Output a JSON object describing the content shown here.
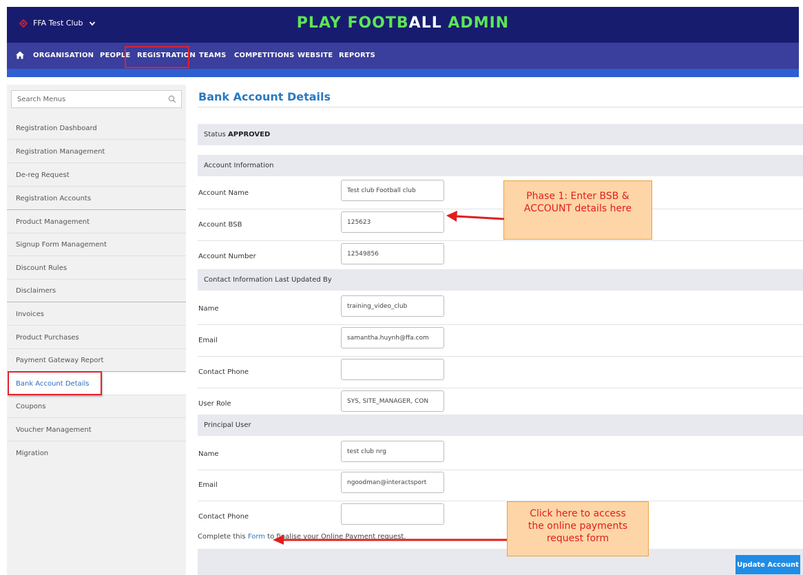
{
  "header": {
    "club_name": "FFA Test Club",
    "brand_part1": "PLAY FOOTB",
    "brand_part2": "ALL",
    "brand_part3": " ADMIN"
  },
  "nav": {
    "items": [
      "ORGANISATION",
      "PEOPLE",
      "REGISTRATION",
      "TEAMS",
      "COMPETITIONS",
      "WEBSITE",
      "REPORTS"
    ],
    "active": "REGISTRATION"
  },
  "sidebar": {
    "search_placeholder": "Search Menus",
    "items": [
      "Registration Dashboard",
      "Registration Management",
      "De-reg Request",
      "Registration Accounts",
      "Product Management",
      "Signup Form Management",
      "Discount Rules",
      "Disclaimers",
      "Invoices",
      "Product Purchases",
      "Payment Gateway Report",
      "Bank Account Details",
      "Coupons",
      "Voucher Management",
      "Migration"
    ],
    "active": "Bank Account Details"
  },
  "page": {
    "title": "Bank Account Details",
    "status_label": "Status ",
    "status_value": "APPROVED",
    "sections": {
      "account": "Account Information",
      "contact": "Contact Information Last Updated By",
      "principal": "Principal User"
    },
    "account": {
      "name_label": "Account Name",
      "name_value": "Test club Football club",
      "bsb_label": "Account BSB",
      "bsb_value": "125623",
      "number_label": "Account Number",
      "number_value": "12549856"
    },
    "contact": {
      "name_label": "Name",
      "name_value": "training_video_club",
      "email_label": "Email",
      "email_value": "samantha.huynh@ffa.com",
      "phone_label": "Contact Phone",
      "phone_value": "",
      "role_label": "User Role",
      "role_value": "SYS, SITE_MANAGER, CON"
    },
    "principal": {
      "name_label": "Name",
      "name_value": "test club nrg",
      "email_label": "Email",
      "email_value": "ngoodman@interactsport",
      "phone_label": "Contact Phone",
      "phone_value": ""
    },
    "form_prefix": "Complete this ",
    "form_link": "Form",
    "form_suffix": " to finalise your Online Payment request.",
    "update_button": "Update Account"
  },
  "callouts": {
    "phase1_line1": "Phase 1: Enter BSB &",
    "phase1_line2": "ACCOUNT details here",
    "click_line1": "Click here to access",
    "click_line2": "the online payments",
    "click_line3": "request form"
  },
  "colors": {
    "topbar": "#181c6f",
    "navbar": "#3a3e9c",
    "brand_green": "#5ce655",
    "accent_blue": "#2b79c2",
    "highlight_red": "#e2202d",
    "button_blue": "#1f8ce5"
  }
}
